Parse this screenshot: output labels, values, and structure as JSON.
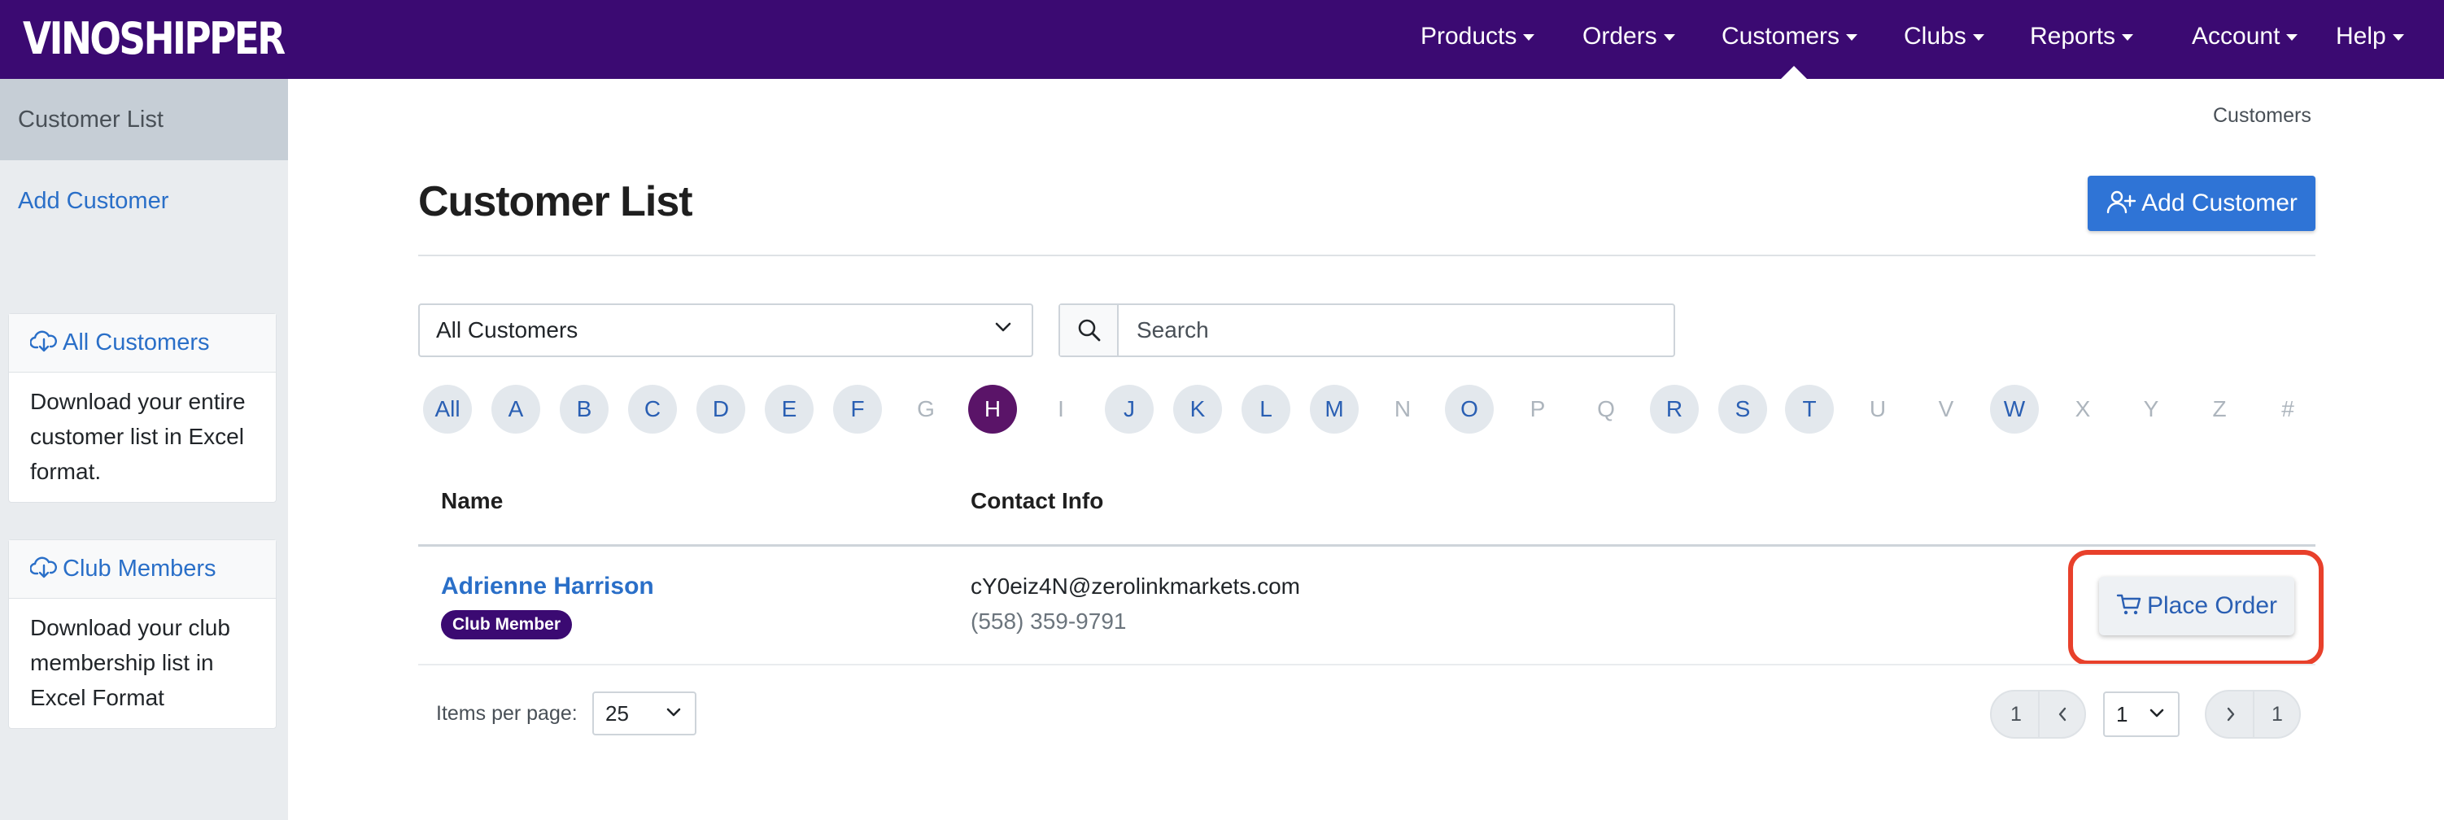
{
  "brand": {
    "logo_text": "VINOSHIPPER"
  },
  "nav": {
    "items": [
      "Products",
      "Orders",
      "Customers",
      "Clubs",
      "Reports",
      "Account",
      "Help"
    ],
    "active": "Customers"
  },
  "sidebar": {
    "active_item": "Customer List",
    "add_link": "Add Customer",
    "cards": [
      {
        "title": "All Customers",
        "body": "Download your entire customer list in Excel format."
      },
      {
        "title": "Club Members",
        "body": "Download your club membership list in Excel Format"
      }
    ]
  },
  "breadcrumb": "Customers",
  "page": {
    "title": "Customer List",
    "add_button": "Add Customer"
  },
  "filters": {
    "segment_value": "All Customers",
    "search_placeholder": "Search"
  },
  "alphabet": {
    "letters": [
      {
        "label": "All",
        "state": "enabled"
      },
      {
        "label": "A",
        "state": "enabled"
      },
      {
        "label": "B",
        "state": "enabled"
      },
      {
        "label": "C",
        "state": "enabled"
      },
      {
        "label": "D",
        "state": "enabled"
      },
      {
        "label": "E",
        "state": "enabled"
      },
      {
        "label": "F",
        "state": "enabled"
      },
      {
        "label": "G",
        "state": "disabled"
      },
      {
        "label": "H",
        "state": "selected"
      },
      {
        "label": "I",
        "state": "disabled"
      },
      {
        "label": "J",
        "state": "enabled"
      },
      {
        "label": "K",
        "state": "enabled"
      },
      {
        "label": "L",
        "state": "enabled"
      },
      {
        "label": "M",
        "state": "enabled"
      },
      {
        "label": "N",
        "state": "disabled"
      },
      {
        "label": "O",
        "state": "enabled"
      },
      {
        "label": "P",
        "state": "disabled"
      },
      {
        "label": "Q",
        "state": "disabled"
      },
      {
        "label": "R",
        "state": "enabled"
      },
      {
        "label": "S",
        "state": "enabled"
      },
      {
        "label": "T",
        "state": "enabled"
      },
      {
        "label": "U",
        "state": "disabled"
      },
      {
        "label": "V",
        "state": "disabled"
      },
      {
        "label": "W",
        "state": "enabled"
      },
      {
        "label": "X",
        "state": "disabled"
      },
      {
        "label": "Y",
        "state": "disabled"
      },
      {
        "label": "Z",
        "state": "disabled"
      },
      {
        "label": "#",
        "state": "disabled"
      }
    ]
  },
  "table": {
    "columns": [
      "Name",
      "Contact Info"
    ],
    "rows": [
      {
        "name": "Adrienne Harrison",
        "badge": "Club Member",
        "email": "cY0eiz4N@zerolinkmarkets.com",
        "phone": "(558) 359-9791",
        "action": "Place Order"
      }
    ]
  },
  "pagination": {
    "items_per_page_label": "Items per page:",
    "items_per_page_value": "25",
    "first_page": "1",
    "current_page": "1",
    "last_page": "1"
  },
  "colors": {
    "nav_bg": "#3b0a72",
    "primary": "#2f74d6",
    "link": "#2a6fc8",
    "selected_letter": "#5a1468",
    "highlight": "#e8402b"
  }
}
